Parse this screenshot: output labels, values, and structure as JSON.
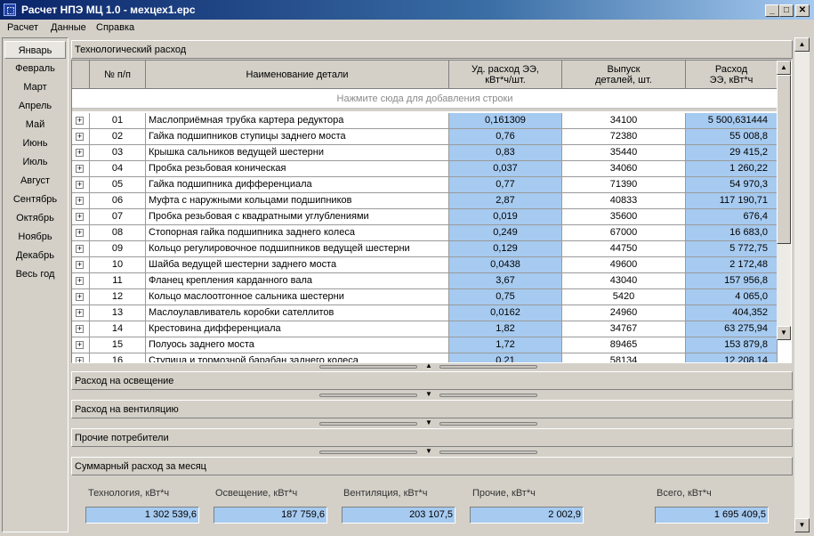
{
  "window": {
    "title": "Расчет НПЭ МЦ 1.0 - мехцех1.epc",
    "buttons": {
      "minimize": "_",
      "maximize": "□",
      "close": "✕"
    }
  },
  "menu": [
    "Расчет",
    "Данные",
    "Справка"
  ],
  "months": [
    "Январь",
    "Февраль",
    "Март",
    "Апрель",
    "Май",
    "Июнь",
    "Июль",
    "Август",
    "Сентябрь",
    "Октябрь",
    "Ноябрь",
    "Декабрь",
    "Весь год"
  ],
  "active_month": "Январь",
  "sections": {
    "tech": "Технологический расход",
    "lighting": "Расход на освещение",
    "ventilation": "Расход на вентиляцию",
    "other": "Прочие потребители",
    "summary": "Суммарный расход за месяц"
  },
  "grid": {
    "columns": [
      "№ п/п",
      "Наименование детали",
      "Уд. расход ЭЭ, кВт*ч/шт.",
      "Выпуск деталей, шт.",
      "Расход ЭЭ, кВт*ч"
    ],
    "add_row": "Нажмите сюда для добавления строки",
    "rows": [
      {
        "n": "01",
        "name": "Маслоприёмная трубка картера редуктора",
        "ud": "0,161309",
        "out": "34100",
        "total": "5 500,631444"
      },
      {
        "n": "02",
        "name": "Гайка подшипников ступицы заднего моста",
        "ud": "0,76",
        "out": "72380",
        "total": "55 008,8"
      },
      {
        "n": "03",
        "name": "Крышка сальников ведущей шестерни",
        "ud": "0,83",
        "out": "35440",
        "total": "29 415,2"
      },
      {
        "n": "04",
        "name": "Пробка резьбовая коническая",
        "ud": "0,037",
        "out": "34060",
        "total": "1 260,22"
      },
      {
        "n": "05",
        "name": "Гайка подшипника дифференциала",
        "ud": "0,77",
        "out": "71390",
        "total": "54 970,3"
      },
      {
        "n": "06",
        "name": "Муфта с наружными кольцами подшипников",
        "ud": "2,87",
        "out": "40833",
        "total": "117 190,71"
      },
      {
        "n": "07",
        "name": "Пробка резьбовая с квадратными углублениями",
        "ud": "0,019",
        "out": "35600",
        "total": "676,4"
      },
      {
        "n": "08",
        "name": "Стопорная гайка подшипника заднего колеса",
        "ud": "0,249",
        "out": "67000",
        "total": "16 683,0"
      },
      {
        "n": "09",
        "name": "Кольцо регулировочное подшипников ведущей шестерни",
        "ud": "0,129",
        "out": "44750",
        "total": "5 772,75"
      },
      {
        "n": "10",
        "name": "Шайба ведущей шестерни заднего моста",
        "ud": "0,0438",
        "out": "49600",
        "total": "2 172,48"
      },
      {
        "n": "11",
        "name": "Фланец крепления карданного вала",
        "ud": "3,67",
        "out": "43040",
        "total": "157 956,8"
      },
      {
        "n": "12",
        "name": "Кольцо маслоотгонное сальника шестерни",
        "ud": "0,75",
        "out": "5420",
        "total": "4 065,0"
      },
      {
        "n": "13",
        "name": "Маслоулавливатель коробки сателлитов",
        "ud": "0,0162",
        "out": "24960",
        "total": "404,352"
      },
      {
        "n": "14",
        "name": "Крестовина дифференциала",
        "ud": "1,82",
        "out": "34767",
        "total": "63 275,94"
      },
      {
        "n": "15",
        "name": "Полуось заднего моста",
        "ud": "1,72",
        "out": "89465",
        "total": "153 879,8"
      },
      {
        "n": "16",
        "name": "Ступица и тормозной барабан заднего колеса",
        "ud": "0,21",
        "out": "58134",
        "total": "12 208,14"
      }
    ]
  },
  "summary": {
    "tech_label": "Технология, кВт*ч",
    "tech_value": "1 302 539,6",
    "light_label": "Освещение, кВт*ч",
    "light_value": "187 759,6",
    "vent_label": "Вентиляция, кВт*ч",
    "vent_value": "203 107,5",
    "other_label": "Прочие, кВт*ч",
    "other_value": "2 002,9",
    "total_label": "Всего, кВт*ч",
    "total_value": "1 695 409,5"
  },
  "colors": {
    "highlight": "#a6caf0",
    "face": "#d4d0c8",
    "title_start": "#0a246a"
  }
}
